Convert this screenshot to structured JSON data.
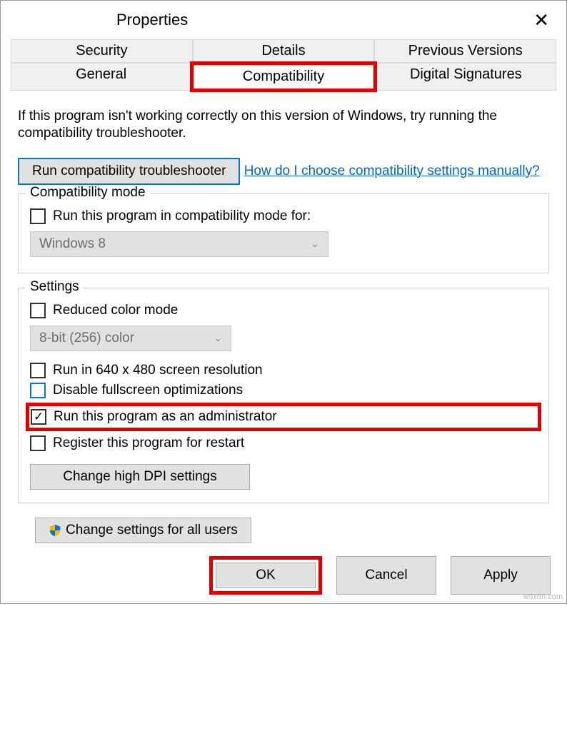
{
  "titlebar": {
    "title": "Properties"
  },
  "tabs": {
    "row1": [
      "Security",
      "Details",
      "Previous Versions"
    ],
    "row2": [
      "General",
      "Compatibility",
      "Digital Signatures"
    ]
  },
  "intro": "If this program isn't working correctly on this version of Windows, try running the compatibility troubleshooter.",
  "troubleshooter_btn": "Run compatibility troubleshooter",
  "manual_link": "How do I choose compatibility settings manually?",
  "compat_group": {
    "title": "Compatibility mode",
    "checkbox": "Run this program in compatibility mode for:",
    "combo": "Windows 8"
  },
  "settings_group": {
    "title": "Settings",
    "reduced_color": "Reduced color mode",
    "color_combo": "8-bit (256) color",
    "res_640": "Run in 640 x 480 screen resolution",
    "disable_fs": "Disable fullscreen optimizations",
    "run_admin": "Run this program as an administrator",
    "register_restart": "Register this program for restart",
    "dpi_btn": "Change high DPI settings"
  },
  "all_users_btn": "Change settings for all users",
  "footer": {
    "ok": "OK",
    "cancel": "Cancel",
    "apply": "Apply"
  },
  "watermark": "wsxdn.com"
}
